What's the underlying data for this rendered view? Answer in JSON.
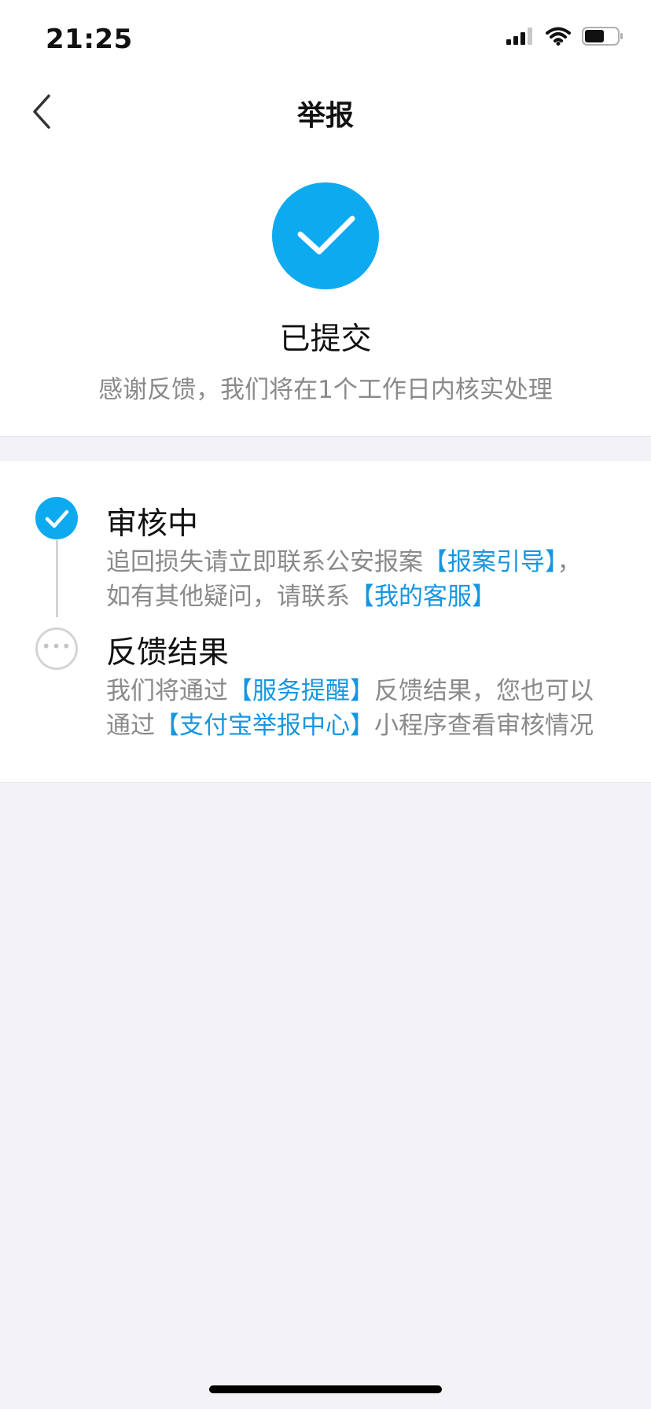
{
  "status_bar": {
    "time": "21:25"
  },
  "nav": {
    "title": "举报"
  },
  "result": {
    "title": "已提交",
    "description": "感谢反馈，我们将在1个工作日内核实处理"
  },
  "steps": [
    {
      "title": "审核中",
      "state": "done",
      "desc_line1_prefix": "追回损失请立即联系公安报案",
      "desc_line1_link": "【报案引导】",
      "desc_line1_suffix": "，",
      "desc_line2_prefix": "如有其他疑问，请联系",
      "desc_line2_link": "【我的客服】"
    },
    {
      "title": "反馈结果",
      "state": "pending",
      "desc_line1_prefix": "我们将通过",
      "desc_line1_link": "【服务提醒】",
      "desc_line1_suffix": "反馈结果，您也可以",
      "desc_line2_prefix": "通过",
      "desc_line2_link": "【支付宝举报中心】",
      "desc_line2_suffix": "小程序查看审核情况"
    }
  ],
  "colors": {
    "accent": "#0daaf0",
    "link": "#1796e0",
    "muted_text": "#8a8a8a",
    "page_background": "#f2f2f7"
  },
  "icons": {
    "back": "chevron-left-icon",
    "success": "checkmark-icon",
    "signal": "cellular-signal-icon",
    "wifi": "wifi-icon",
    "battery": "battery-icon",
    "pending": "ellipsis-icon"
  }
}
